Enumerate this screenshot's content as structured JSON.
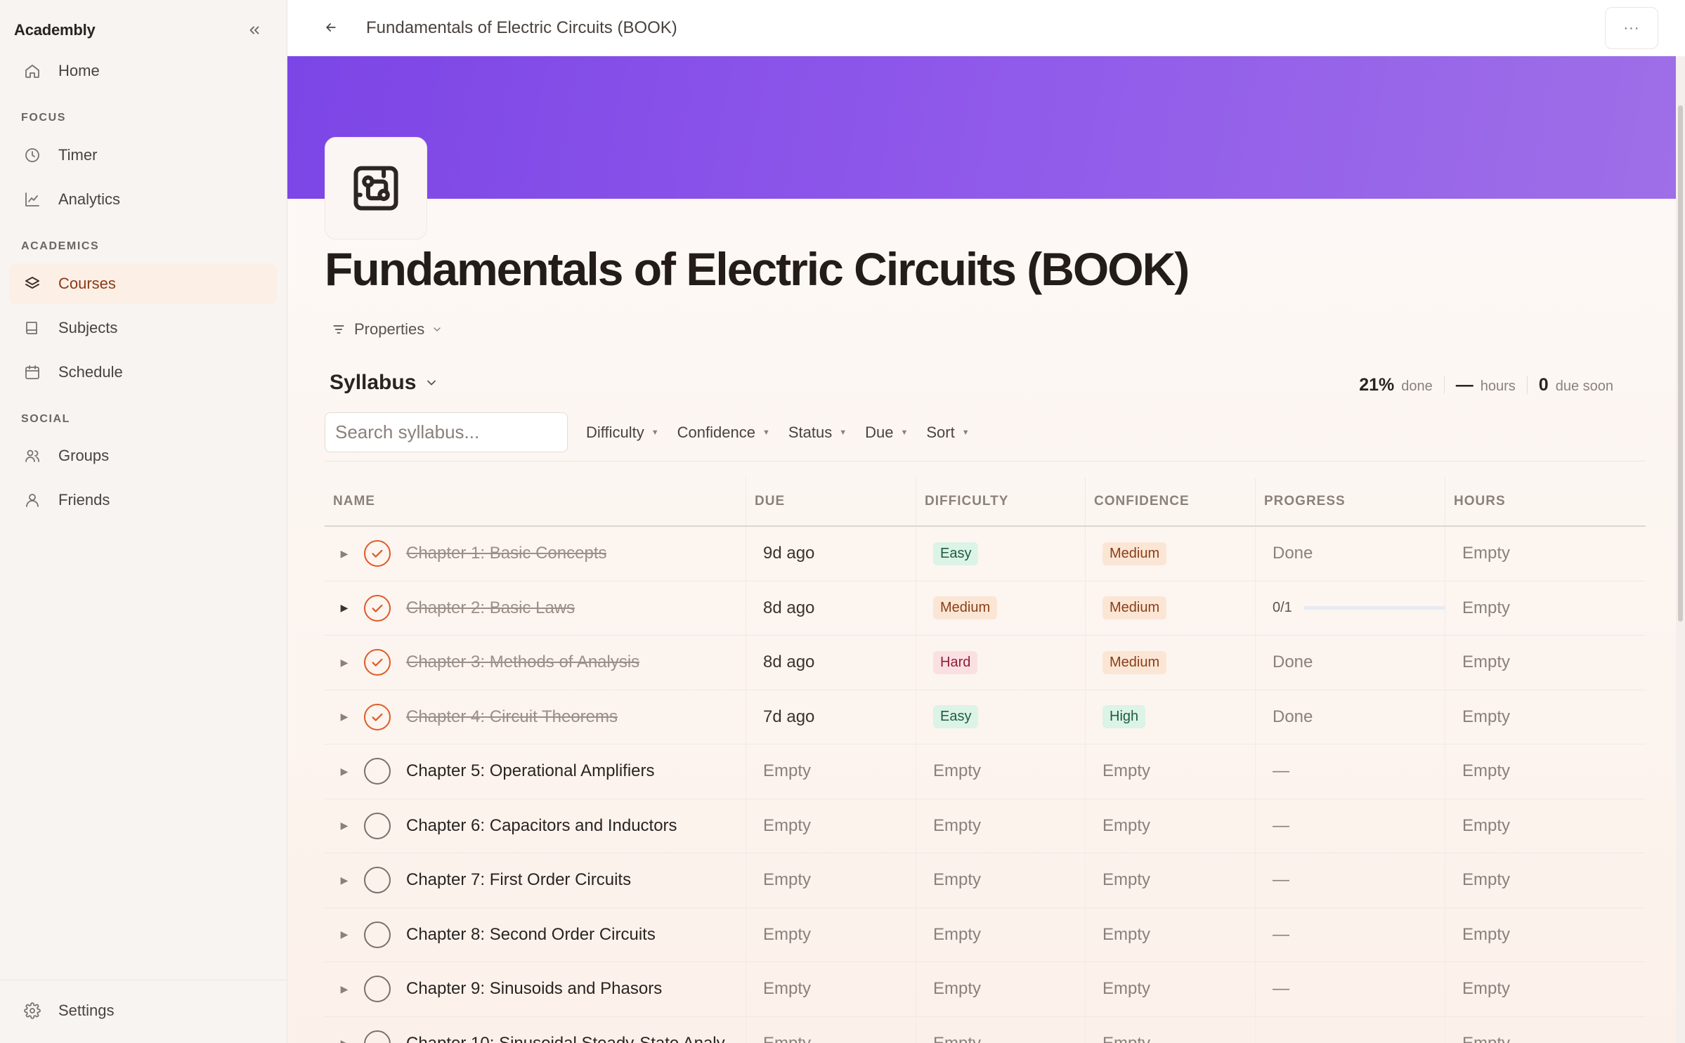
{
  "brand": "Academbly",
  "sidebar": {
    "home": "Home",
    "sections": {
      "focus": "FOCUS",
      "academics": "ACADEMICS",
      "social": "SOCIAL"
    },
    "focus_items": [
      "Timer",
      "Analytics"
    ],
    "academics_items": [
      "Courses",
      "Subjects",
      "Schedule"
    ],
    "social_items": [
      "Groups",
      "Friends"
    ],
    "settings": "Settings",
    "active": "Courses"
  },
  "topbar": {
    "title": "Fundamentals of Electric Circuits (BOOK)",
    "more": "···"
  },
  "page": {
    "title": "Fundamentals of Electric Circuits (BOOK)",
    "properties": "Properties"
  },
  "syllabus": {
    "title": "Syllabus",
    "stats": {
      "done_value": "21%",
      "done_label": "done",
      "hours_value": "—",
      "hours_label": "hours",
      "due_value": "0",
      "due_label": "due soon"
    },
    "search_placeholder": "Search syllabus...",
    "filters": [
      "Difficulty",
      "Confidence",
      "Status",
      "Due",
      "Sort"
    ],
    "columns": {
      "name": "NAME",
      "due": "DUE",
      "difficulty": "DIFFICULTY",
      "confidence": "CONFIDENCE",
      "progress": "PROGRESS",
      "hours": "HOURS"
    },
    "rows": [
      {
        "name": "Chapter 1: Basic Concepts",
        "done": true,
        "due": "9d ago",
        "difficulty": "Easy",
        "confidence": "Medium",
        "progress": "Done",
        "hours": "Empty"
      },
      {
        "name": "Chapter 2: Basic Laws",
        "done": true,
        "due": "8d ago",
        "difficulty": "Medium",
        "confidence": "Medium",
        "progress": "0/1",
        "progress_fraction": 0,
        "hours": "Empty"
      },
      {
        "name": "Chapter 3: Methods of Analysis",
        "done": true,
        "due": "8d ago",
        "difficulty": "Hard",
        "confidence": "Medium",
        "progress": "Done",
        "hours": "Empty"
      },
      {
        "name": "Chapter 4: Circuit Theorems",
        "done": true,
        "due": "7d ago",
        "difficulty": "Easy",
        "confidence": "High",
        "progress": "Done",
        "hours": "Empty"
      },
      {
        "name": "Chapter 5: Operational Amplifiers",
        "done": false,
        "due": "Empty",
        "difficulty": "Empty",
        "confidence": "Empty",
        "progress": "—",
        "hours": "Empty"
      },
      {
        "name": "Chapter 6: Capacitors and Inductors",
        "done": false,
        "due": "Empty",
        "difficulty": "Empty",
        "confidence": "Empty",
        "progress": "—",
        "hours": "Empty"
      },
      {
        "name": "Chapter 7: First Order Circuits",
        "done": false,
        "due": "Empty",
        "difficulty": "Empty",
        "confidence": "Empty",
        "progress": "—",
        "hours": "Empty"
      },
      {
        "name": "Chapter 8: Second Order Circuits",
        "done": false,
        "due": "Empty",
        "difficulty": "Empty",
        "confidence": "Empty",
        "progress": "—",
        "hours": "Empty"
      },
      {
        "name": "Chapter 9: Sinusoids and Phasors",
        "done": false,
        "due": "Empty",
        "difficulty": "Empty",
        "confidence": "Empty",
        "progress": "—",
        "hours": "Empty"
      },
      {
        "name": "Chapter 10: Sinusoidal Steady-State Analy",
        "done": false,
        "due": "Empty",
        "difficulty": "Empty",
        "confidence": "Empty",
        "progress": "—",
        "hours": "Empty"
      }
    ]
  },
  "colors": {
    "banner_start": "#7c45e6",
    "banner_end": "#9e6fe8",
    "accent_check": "#e05a28",
    "active_nav_bg": "#fcefe6"
  }
}
